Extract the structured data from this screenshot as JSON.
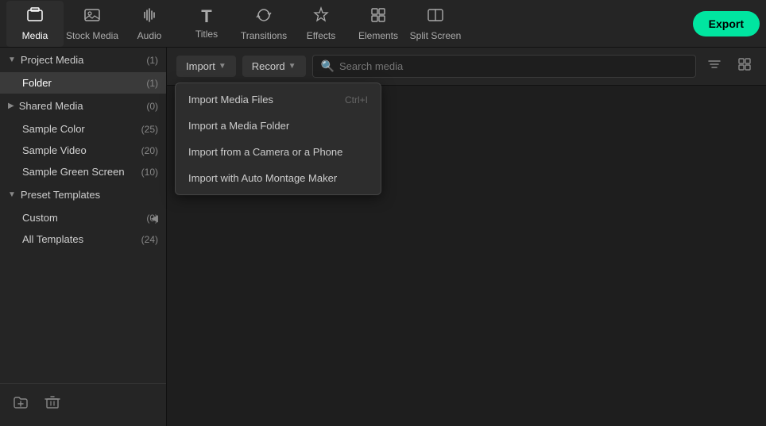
{
  "topNav": {
    "items": [
      {
        "id": "media",
        "label": "Media",
        "icon": "🗂",
        "active": true
      },
      {
        "id": "stock-media",
        "label": "Stock Media",
        "icon": "🖼"
      },
      {
        "id": "audio",
        "label": "Audio",
        "icon": "♪"
      },
      {
        "id": "titles",
        "label": "Titles",
        "icon": "T"
      },
      {
        "id": "transitions",
        "label": "Transitions",
        "icon": "⇌"
      },
      {
        "id": "effects",
        "label": "Effects",
        "icon": "✦"
      },
      {
        "id": "elements",
        "label": "Elements",
        "icon": "⬜"
      },
      {
        "id": "split-screen",
        "label": "Split Screen",
        "icon": "⊟"
      }
    ],
    "exportLabel": "Export"
  },
  "toolbar": {
    "importLabel": "Import",
    "recordLabel": "Record",
    "searchPlaceholder": "Search media"
  },
  "dropdown": {
    "items": [
      {
        "id": "import-media-files",
        "label": "Import Media Files",
        "shortcut": "Ctrl+I"
      },
      {
        "id": "import-media-folder",
        "label": "Import a Media Folder",
        "shortcut": ""
      },
      {
        "id": "import-camera",
        "label": "Import from a Camera or a Phone",
        "shortcut": ""
      },
      {
        "id": "import-auto-montage",
        "label": "Import with Auto Montage Maker",
        "shortcut": ""
      }
    ]
  },
  "sidebar": {
    "projectMedia": {
      "label": "Project Media",
      "count": "(1)",
      "items": [
        {
          "id": "folder",
          "label": "Folder",
          "count": "(1)",
          "active": true
        }
      ]
    },
    "sharedMedia": {
      "label": "Shared Media",
      "count": "(0)"
    },
    "sampleItems": [
      {
        "id": "sample-color",
        "label": "Sample Color",
        "count": "(25)"
      },
      {
        "id": "sample-video",
        "label": "Sample Video",
        "count": "(20)"
      },
      {
        "id": "sample-green-screen",
        "label": "Sample Green Screen",
        "count": "(10)"
      }
    ],
    "presetTemplates": {
      "label": "Preset Templates",
      "count": "",
      "items": [
        {
          "id": "custom",
          "label": "Custom",
          "count": "(0)"
        },
        {
          "id": "all-templates",
          "label": "All Templates",
          "count": "(24)"
        }
      ]
    }
  }
}
